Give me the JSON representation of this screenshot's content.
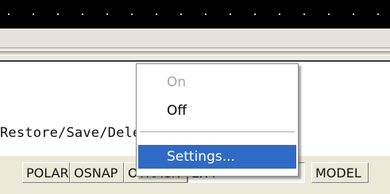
{
  "command_line": {
    "text": "Restore/Save/Delete/State/?/Wo",
    "history_line": ""
  },
  "context_menu": {
    "items": [
      {
        "label": "On",
        "disabled": true
      },
      {
        "label": "Off",
        "disabled": false
      },
      {
        "label": "Settings...",
        "highlighted": true
      }
    ]
  },
  "status_bar": {
    "buttons": [
      {
        "label": "POLAR",
        "pressed": false
      },
      {
        "label": "OSNAP",
        "pressed": false
      },
      {
        "label": "OTRACK",
        "pressed": false
      },
      {
        "label": "LWT",
        "pressed": true
      },
      {
        "label": "MODEL",
        "pressed": false
      }
    ]
  },
  "colors": {
    "menu_highlight": "#316ac5",
    "drawing_background": "#000000",
    "disabled_text": "#a7a6aa"
  }
}
